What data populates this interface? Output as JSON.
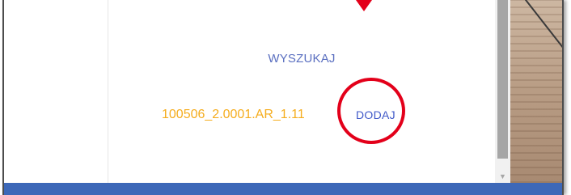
{
  "search": {
    "label": "WYSZUKAJ"
  },
  "result": {
    "code": "100506_2.0001.AR_1.11",
    "add_label": "DODAJ"
  },
  "colors": {
    "search_link": "#5a6fc0",
    "code_text": "#f5ad1e",
    "add_link": "#3f58c8",
    "annotation": "#e3001a",
    "bottom_bar": "#3d68b8"
  },
  "icons": {
    "scroll_down": "scroll-down-arrow-icon",
    "annotation_arrow": "annotation-arrow-icon"
  }
}
